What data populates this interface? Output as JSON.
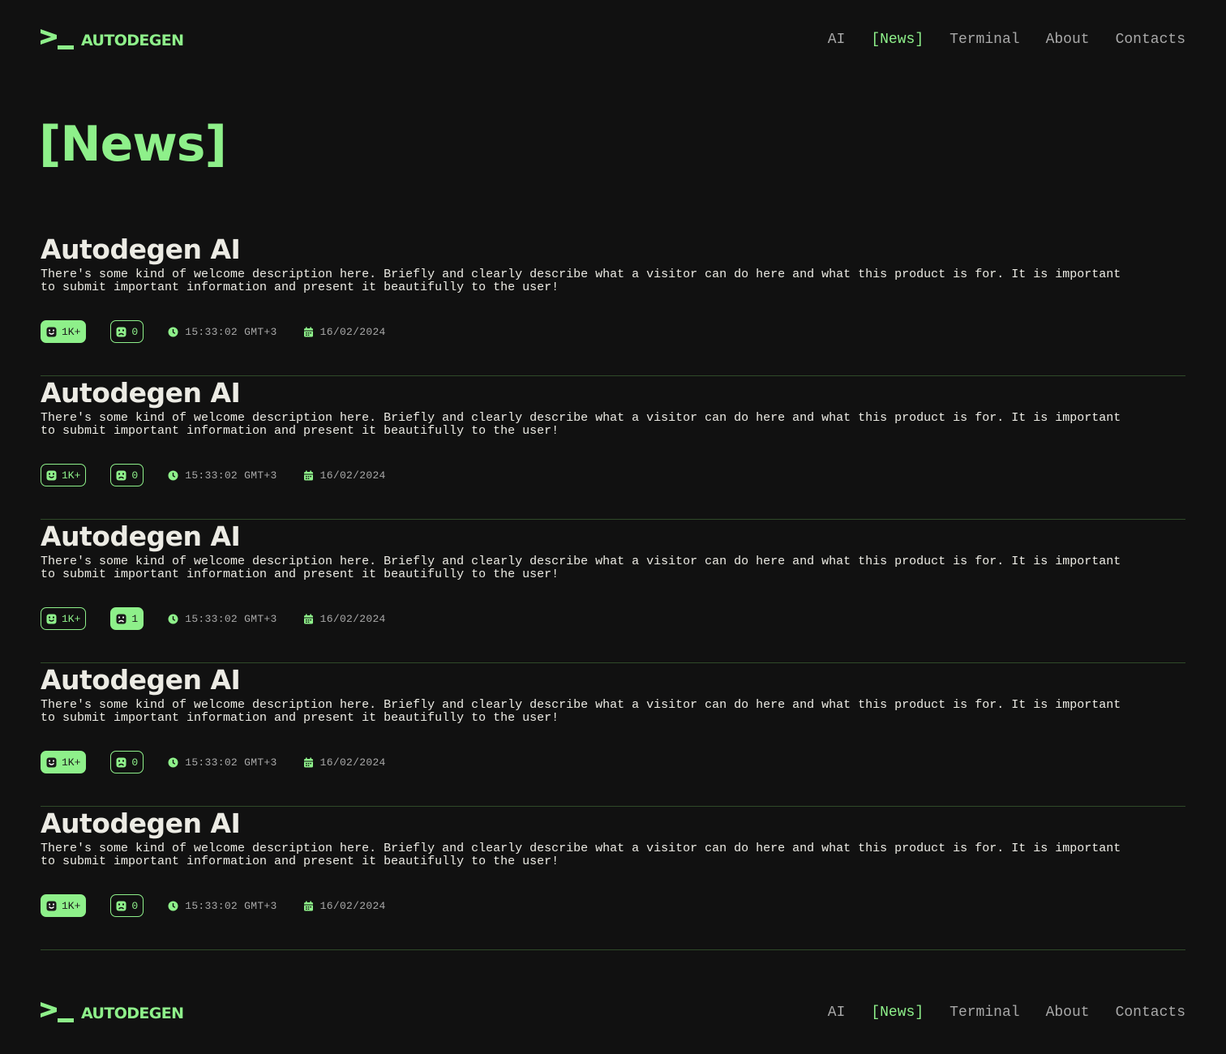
{
  "brand": {
    "name": "AUTODEGEN",
    "accent_color": "#8ef08a",
    "background_color": "#111111"
  },
  "nav": {
    "items": [
      {
        "label": "AI"
      },
      {
        "label": "[News]"
      },
      {
        "label": "Terminal"
      },
      {
        "label": "About"
      },
      {
        "label": "Contacts"
      }
    ],
    "active_index": 1
  },
  "page": {
    "title": "[News]"
  },
  "news": [
    {
      "title": "Autodegen AI",
      "description": "There's some kind of welcome description here. Briefly and clearly describe what a visitor can do here and what this product is for. It is important to submit important information and present it beautifully to the user!",
      "likes": "1K+",
      "likes_active": true,
      "dislikes": "0",
      "dislikes_active": false,
      "time": "15:33:02 GMT+3",
      "date": "16/02/2024",
      "like_icon": "smile-icon",
      "dislike_icon": "sad-icon",
      "time_icon": "clock-icon",
      "date_icon": "calendar-icon"
    },
    {
      "title": "Autodegen AI",
      "description": "There's some kind of welcome description here. Briefly and clearly describe what a visitor can do here and what this product is for. It is important to submit important information and present it beautifully to the user!",
      "likes": "1K+",
      "likes_active": false,
      "dislikes": "0",
      "dislikes_active": false,
      "time": "15:33:02 GMT+3",
      "date": "16/02/2024"
    },
    {
      "title": "Autodegen AI",
      "description": "There's some kind of welcome description here. Briefly and clearly describe what a visitor can do here and what this product is for. It is important to submit important information and present it beautifully to the user!",
      "likes": "1K+",
      "likes_active": false,
      "dislikes": "1",
      "dislikes_active": true,
      "time": "15:33:02 GMT+3",
      "date": "16/02/2024"
    },
    {
      "title": "Autodegen AI",
      "description": "There's some kind of welcome description here. Briefly and clearly describe what a visitor can do here and what this product is for. It is important to submit important information and present it beautifully to the user!",
      "likes": "1K+",
      "likes_active": true,
      "dislikes": "0",
      "dislikes_active": false,
      "time": "15:33:02 GMT+3",
      "date": "16/02/2024"
    },
    {
      "title": "Autodegen AI",
      "description": "There's some kind of welcome description here. Briefly and clearly describe what a visitor can do here and what this product is for. It is important to submit important information and present it beautifully to the user!",
      "likes": "1K+",
      "likes_active": true,
      "dislikes": "0",
      "dislikes_active": false,
      "time": "15:33:02 GMT+3",
      "date": "16/02/2024"
    }
  ]
}
